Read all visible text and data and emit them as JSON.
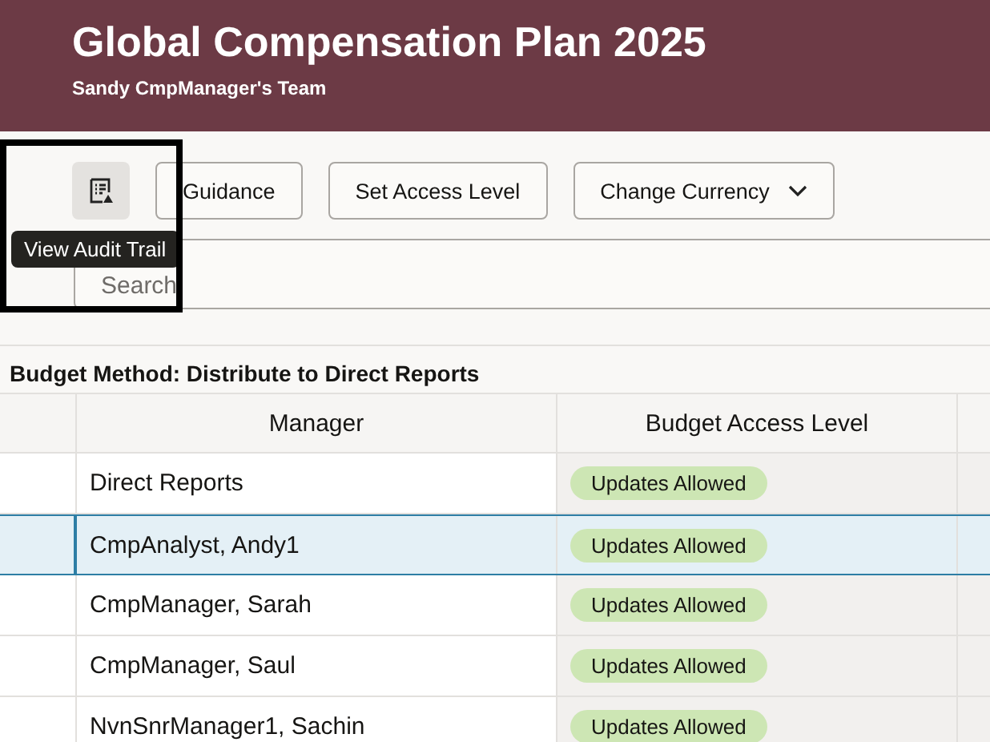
{
  "header": {
    "title": "Global Compensation Plan 2025",
    "subtitle": "Sandy CmpManager's Team"
  },
  "toolbar": {
    "icon_button_tooltip": "View Audit Trail",
    "buttons": [
      {
        "label": "Guidance",
        "kind": "plain"
      },
      {
        "label": "Set Access Level",
        "kind": "plain"
      },
      {
        "label": "Change Currency",
        "kind": "menu"
      }
    ]
  },
  "search": {
    "placeholder": "Search"
  },
  "budget_method": "Budget Method: Distribute to Direct Reports",
  "table": {
    "columns": [
      "Manager",
      "Budget Access Level"
    ],
    "rows": [
      {
        "manager": "Direct Reports",
        "access": "Updates Allowed",
        "selected": false
      },
      {
        "manager": "CmpAnalyst, Andy1",
        "access": "Updates Allowed",
        "selected": true
      },
      {
        "manager": "CmpManager, Sarah",
        "access": "Updates Allowed",
        "selected": false
      },
      {
        "manager": "CmpManager, Saul",
        "access": "Updates Allowed",
        "selected": false
      },
      {
        "manager": "NvnSnrManager1, Sachin",
        "access": "Updates Allowed",
        "selected": false
      }
    ]
  }
}
